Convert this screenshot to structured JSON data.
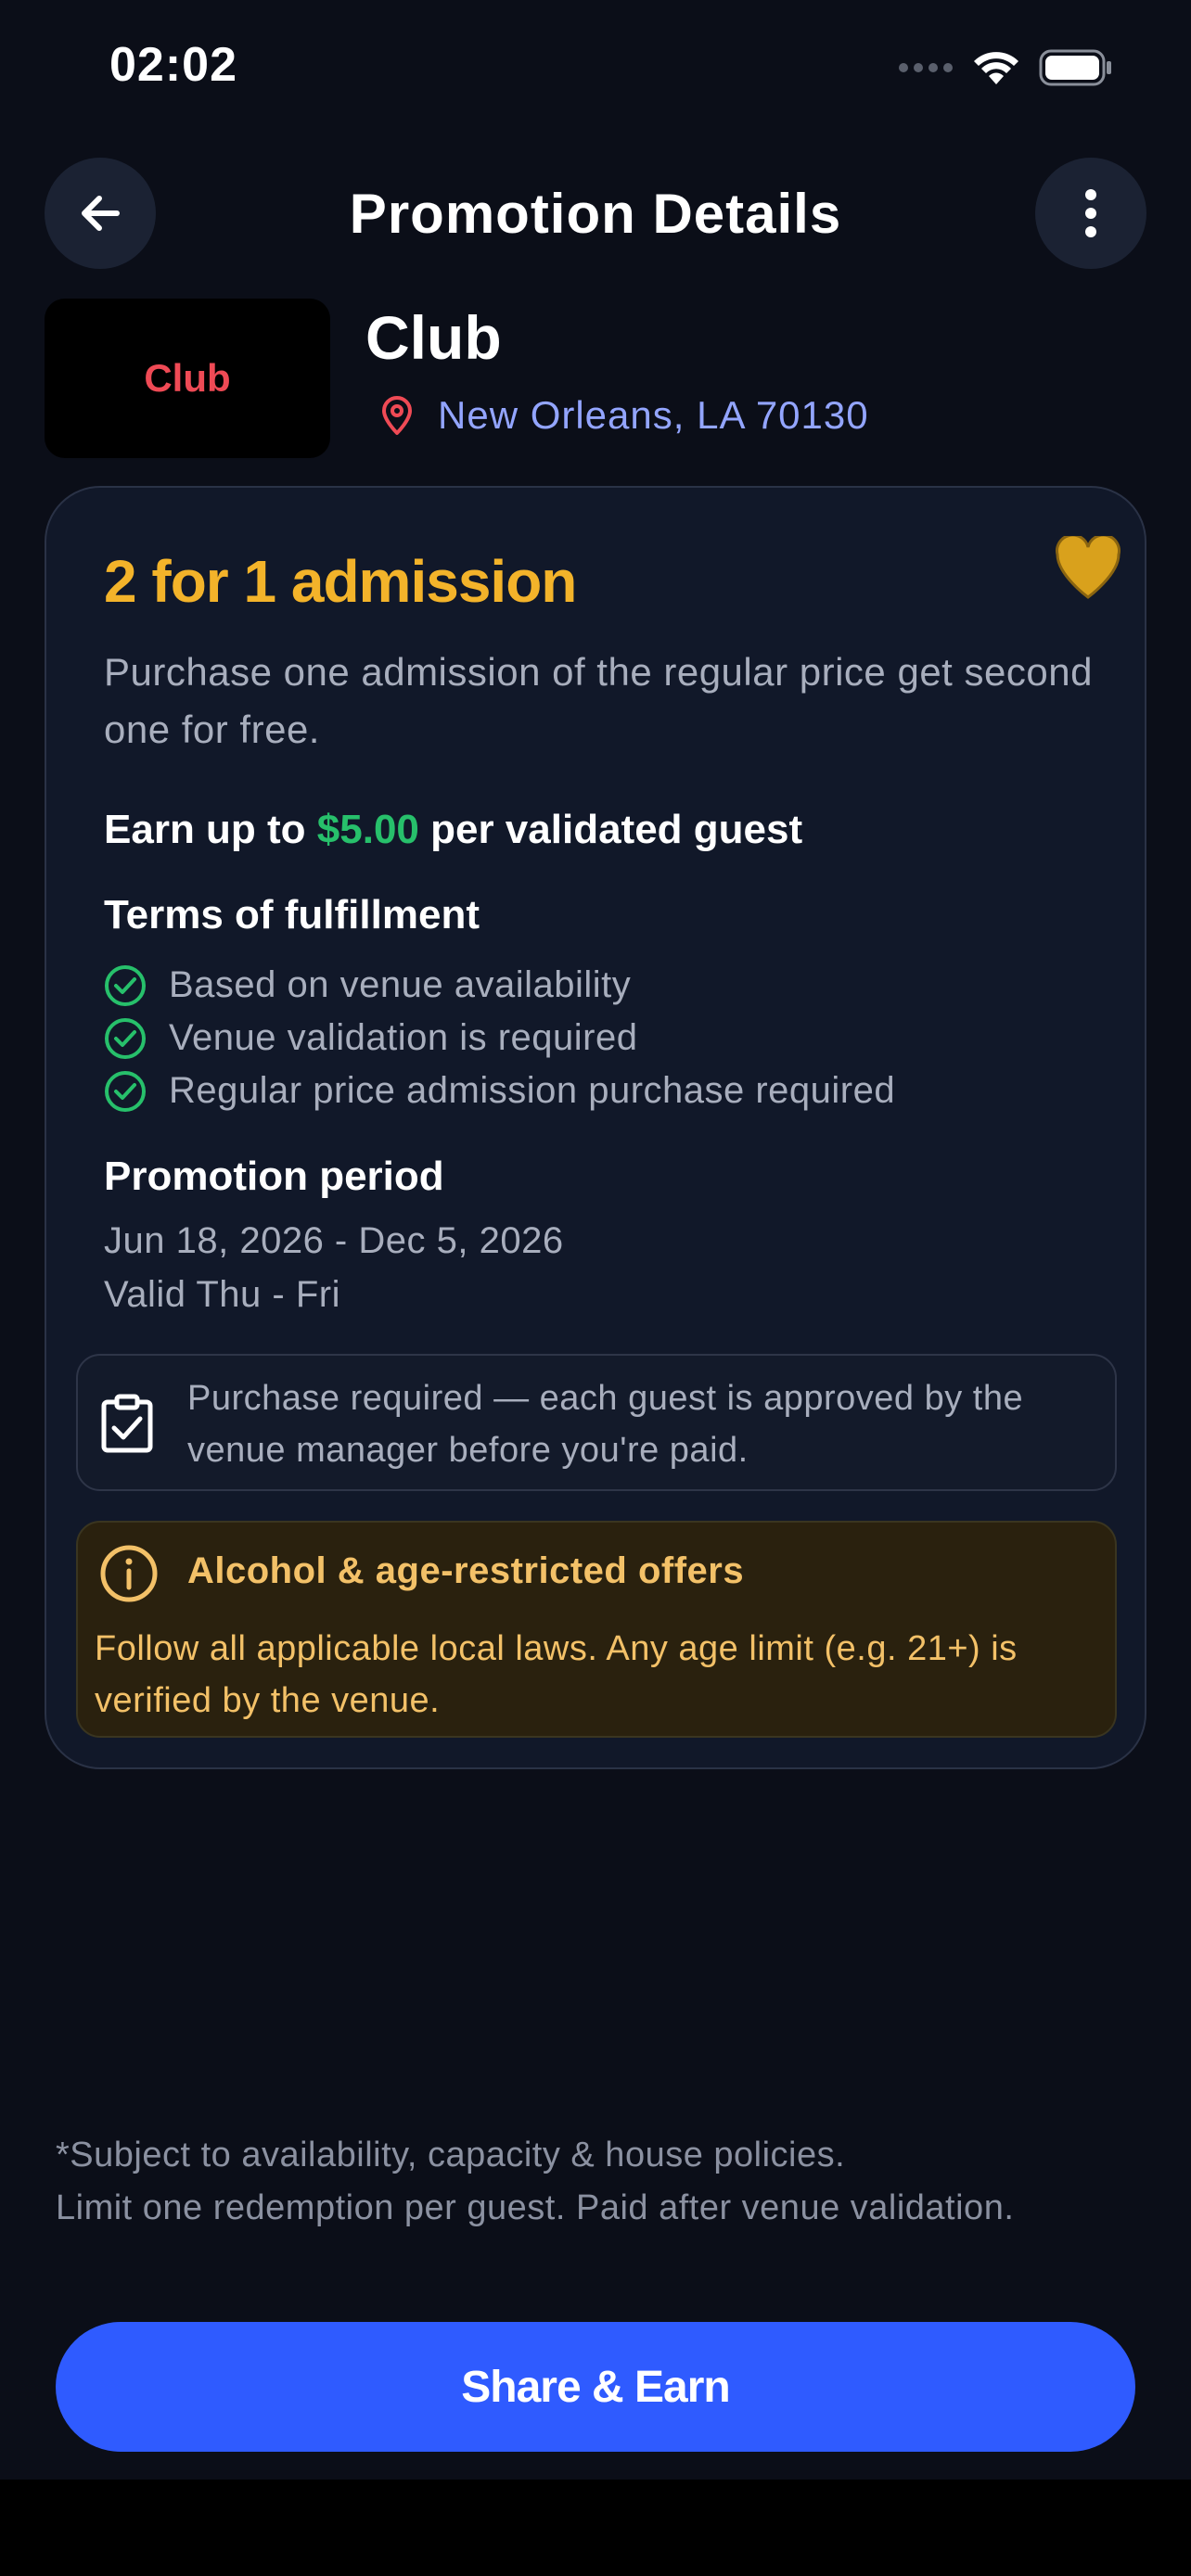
{
  "status_bar": {
    "time": "02:02"
  },
  "header": {
    "title": "Promotion Details",
    "back_icon": "arrow-left-icon",
    "more_icon": "more-vertical-icon"
  },
  "venue": {
    "logo_text": "Club",
    "name": "Club",
    "location": "New Orleans, LA 70130",
    "location_icon": "map-pin-icon"
  },
  "promotion": {
    "title": "2 for 1 admission",
    "description": "Purchase one admission of the regular price get second one for free.",
    "earn_prefix": "Earn up to ",
    "earn_amount": "$5.00",
    "earn_suffix": " per validated guest",
    "favorite_icon": "heart-icon",
    "terms_title": "Terms of fulfillment",
    "terms": [
      "Based on venue availability",
      "Venue validation is required",
      "Regular price admission purchase required"
    ],
    "period_title": "Promotion period",
    "period_dates": "Jun 18, 2026 - Dec 5, 2026",
    "period_days": "Valid Thu - Fri",
    "purchase_note": "Purchase required — each guest is approved by the venue manager before you're paid.",
    "alcohol_title": "Alcohol & age-restricted offers",
    "alcohol_text": "Follow all applicable local laws. Any age limit (e.g. 21+) is verified by the venue."
  },
  "footer": {
    "note_line1": "*Subject to availability, capacity & house policies.",
    "note_line2": "Limit one redemption per guest. Paid after venue validation.",
    "share_label": "Share & Earn"
  },
  "colors": {
    "background": "#0b0e18",
    "accent_blue": "#2f5bff",
    "promo_gold": "#f3b32a",
    "earn_green": "#27c06b",
    "location_blue": "#93a5ff",
    "logo_red": "#ef4a55"
  }
}
